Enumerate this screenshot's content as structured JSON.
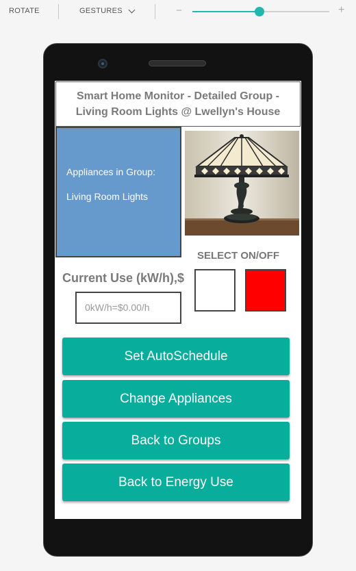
{
  "toolbar": {
    "rotate_label": "ROTATE",
    "gestures_label": "GESTURES",
    "zoom_minus": "−",
    "zoom_plus": "+",
    "zoom_level": 0.49
  },
  "app": {
    "title": "Smart Home Monitor - Detailed Group - Living Room Lights @ Lwellyn's House",
    "group_heading": "Appliances in Group:",
    "group_name": "Living Room Lights",
    "select_label": "SELECT ON/OFF",
    "current_use_label": "Current Use (kW/h),$",
    "current_use_placeholder": "0kW/h=$0.00/h",
    "switch_colors": {
      "off": "#ffffff",
      "on": "#ff0000"
    },
    "buttons": [
      {
        "label": "Set AutoSchedule"
      },
      {
        "label": "Change Appliances"
      },
      {
        "label": "Back to Groups"
      },
      {
        "label": "Back to Energy Use"
      }
    ]
  },
  "colors": {
    "accent": "#22b7ad",
    "button": "#08ad9c",
    "group_panel": "#6699cc"
  }
}
